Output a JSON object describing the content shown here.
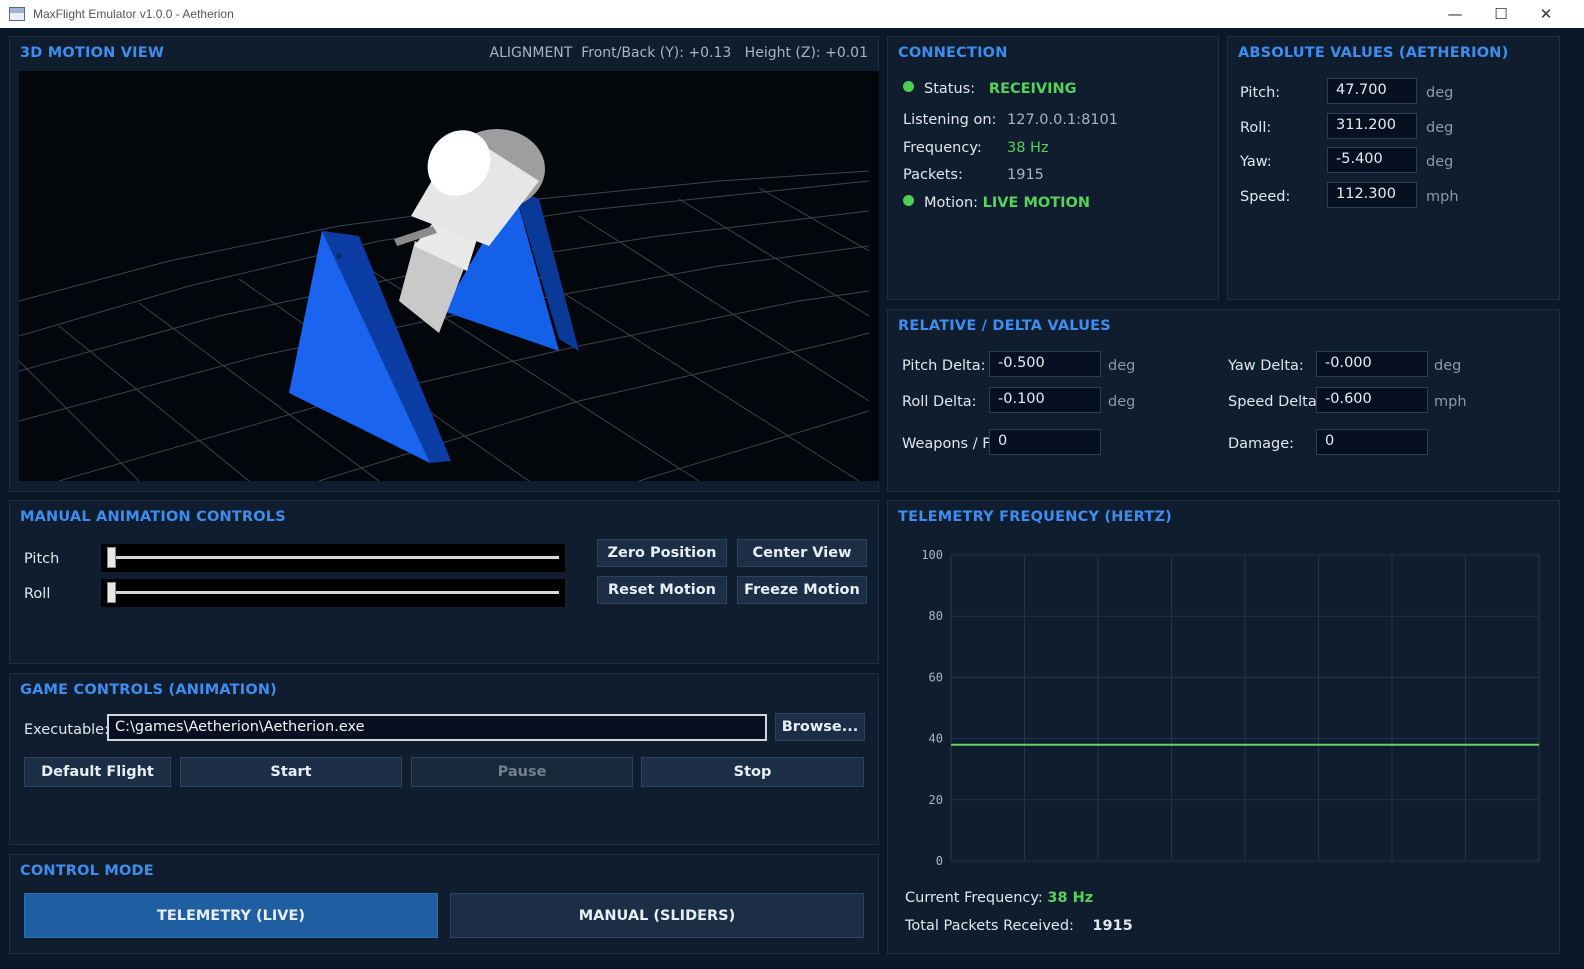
{
  "window": {
    "title": "MaxFlight Emulator v1.0.0 - Aetherion",
    "minimize": "—",
    "maximize": "☐",
    "close": "✕"
  },
  "motion_view": {
    "title": "3D MOTION VIEW",
    "alignment": "ALIGNMENT  Front/Back (Y): +0.13   Height (Z): +0.01"
  },
  "connection": {
    "title": "CONNECTION",
    "status_label": "Status:",
    "status_value": "RECEIVING",
    "listening_label": "Listening on:",
    "listening_value": "127.0.0.1:8101",
    "frequency_label": "Frequency:",
    "frequency_value": "38 Hz",
    "packets_label": "Packets:",
    "packets_value": "1915",
    "motion_label": "Motion:",
    "motion_value": "LIVE MOTION"
  },
  "absolute": {
    "title": "ABSOLUTE VALUES (AETHERION)",
    "pitch_label": "Pitch:",
    "pitch_value": "47.700",
    "pitch_unit": "deg",
    "roll_label": "Roll:",
    "roll_value": "311.200",
    "roll_unit": "deg",
    "yaw_label": "Yaw:",
    "yaw_value": "-5.400",
    "yaw_unit": "deg",
    "speed_label": "Speed:",
    "speed_value": "112.300",
    "speed_unit": "mph"
  },
  "relative": {
    "title": "RELATIVE / DELTA VALUES",
    "pitch_delta_label": "Pitch Delta:",
    "pitch_delta_value": "-0.500",
    "pitch_delta_unit": "deg",
    "roll_delta_label": "Roll Delta:",
    "roll_delta_value": "-0.100",
    "roll_delta_unit": "deg",
    "weapons_label": "Weapons / F",
    "weapons_value": "0",
    "yaw_delta_label": "Yaw Delta:",
    "yaw_delta_value": "-0.000",
    "yaw_delta_unit": "deg",
    "speed_delta_label": "Speed Delta:",
    "speed_delta_value": "-0.600",
    "speed_delta_unit": "mph",
    "damage_label": "Damage:",
    "damage_value": "0"
  },
  "manual": {
    "title": "MANUAL ANIMATION CONTROLS",
    "pitch_label": "Pitch",
    "roll_label": "Roll",
    "pitch_level": 0,
    "roll_level": 0,
    "zero_position": "Zero Position",
    "center_view": "Center View",
    "reset_motion": "Reset Motion",
    "freeze_motion": "Freeze Motion"
  },
  "game": {
    "title": "GAME CONTROLS (ANIMATION)",
    "executable_label": "Executable:",
    "executable_value": "C:\\games\\Aetherion\\Aetherion.exe",
    "browse": "Browse...",
    "default_flight": "Default Flight",
    "start": "Start",
    "pause": "Pause",
    "stop": "Stop"
  },
  "control_mode": {
    "title": "CONTROL MODE",
    "telemetry": "TELEMETRY (LIVE)",
    "manual": "MANUAL (SLIDERS)"
  },
  "telemetry": {
    "title": "TELEMETRY FREQUENCY (HERTZ)",
    "current_label": "Current Frequency:",
    "current_value": "38 Hz",
    "total_label": "Total Packets Received:",
    "total_value": "1915"
  },
  "chart_data": {
    "type": "line",
    "ylim": [
      0,
      100
    ],
    "yticks": [
      "100",
      "80",
      "60",
      "40",
      "20",
      "0"
    ],
    "grid": true,
    "series": [
      {
        "values": [
          38,
          38,
          38,
          38,
          38,
          38,
          38,
          38,
          38,
          38,
          38,
          38,
          38,
          38,
          38,
          38,
          38,
          38,
          38,
          38,
          38,
          38,
          38,
          38,
          38,
          38,
          38,
          38,
          38,
          38,
          38,
          38,
          38,
          38,
          38,
          38,
          38,
          38,
          38,
          38
        ]
      }
    ],
    "line_color": "#6ad25f"
  }
}
